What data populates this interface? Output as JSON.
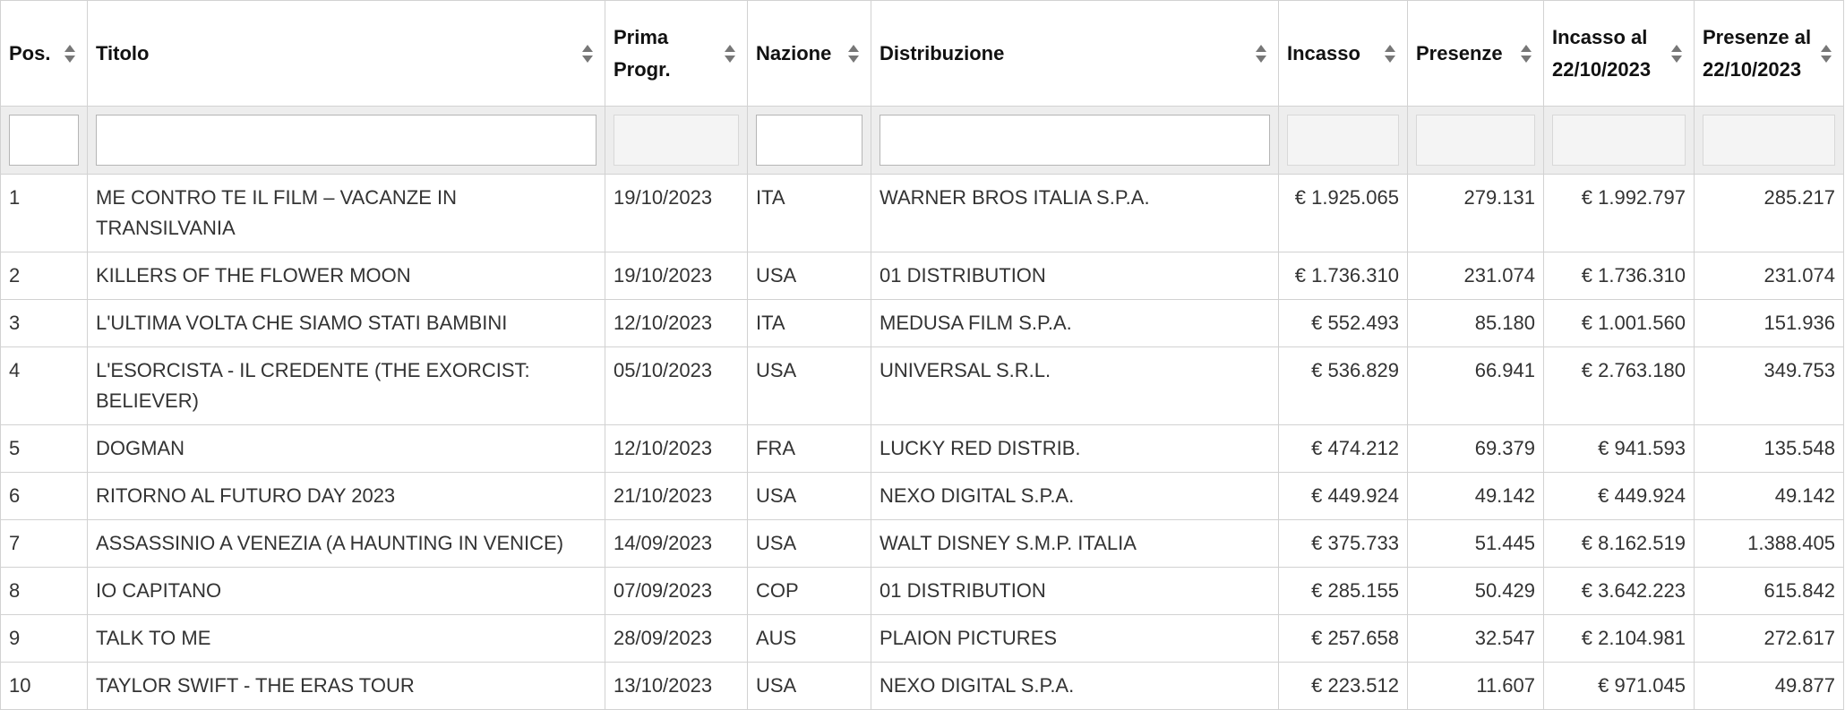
{
  "table": {
    "columns": [
      {
        "key": "pos",
        "label": "Pos."
      },
      {
        "key": "titolo",
        "label": "Titolo"
      },
      {
        "key": "prima",
        "label": "Prima Progr."
      },
      {
        "key": "nazione",
        "label": "Nazione"
      },
      {
        "key": "distribuzione",
        "label": "Distribuzione"
      },
      {
        "key": "incasso",
        "label": "Incasso"
      },
      {
        "key": "presenze",
        "label": "Presenze"
      },
      {
        "key": "incasso_al",
        "label": "Incasso al 22/10/2023"
      },
      {
        "key": "presenze_al",
        "label": "Presenze al 22/10/2023"
      }
    ],
    "filters": {
      "pos": "",
      "titolo": "",
      "prima": "",
      "nazione": "",
      "distribuzione": "",
      "incasso": "",
      "presenze": "",
      "incasso_al": "",
      "presenze_al": ""
    },
    "rows": [
      {
        "pos": "1",
        "titolo": "ME CONTRO TE IL FILM – VACANZE IN TRANSILVANIA",
        "prima": "19/10/2023",
        "nazione": "ITA",
        "distribuzione": "WARNER BROS ITALIA S.P.A.",
        "incasso": "€ 1.925.065",
        "presenze": "279.131",
        "incasso_al": "€ 1.992.797",
        "presenze_al": "285.217"
      },
      {
        "pos": "2",
        "titolo": "KILLERS OF THE FLOWER MOON",
        "prima": "19/10/2023",
        "nazione": "USA",
        "distribuzione": "01 DISTRIBUTION",
        "incasso": "€ 1.736.310",
        "presenze": "231.074",
        "incasso_al": "€ 1.736.310",
        "presenze_al": "231.074"
      },
      {
        "pos": "3",
        "titolo": "L'ULTIMA VOLTA CHE SIAMO STATI BAMBINI",
        "prima": "12/10/2023",
        "nazione": "ITA",
        "distribuzione": "MEDUSA FILM S.P.A.",
        "incasso": "€ 552.493",
        "presenze": "85.180",
        "incasso_al": "€ 1.001.560",
        "presenze_al": "151.936"
      },
      {
        "pos": "4",
        "titolo": "L'ESORCISTA - IL CREDENTE (THE EXORCIST: BELIEVER)",
        "prima": "05/10/2023",
        "nazione": "USA",
        "distribuzione": "UNIVERSAL S.R.L.",
        "incasso": "€ 536.829",
        "presenze": "66.941",
        "incasso_al": "€ 2.763.180",
        "presenze_al": "349.753"
      },
      {
        "pos": "5",
        "titolo": "DOGMAN",
        "prima": "12/10/2023",
        "nazione": "FRA",
        "distribuzione": "LUCKY RED DISTRIB.",
        "incasso": "€ 474.212",
        "presenze": "69.379",
        "incasso_al": "€ 941.593",
        "presenze_al": "135.548"
      },
      {
        "pos": "6",
        "titolo": "RITORNO AL FUTURO DAY 2023",
        "prima": "21/10/2023",
        "nazione": "USA",
        "distribuzione": "NEXO DIGITAL S.P.A.",
        "incasso": "€ 449.924",
        "presenze": "49.142",
        "incasso_al": "€ 449.924",
        "presenze_al": "49.142"
      },
      {
        "pos": "7",
        "titolo": "ASSASSINIO A VENEZIA (A HAUNTING IN VENICE)",
        "prima": "14/09/2023",
        "nazione": "USA",
        "distribuzione": "WALT DISNEY S.M.P. ITALIA",
        "incasso": "€ 375.733",
        "presenze": "51.445",
        "incasso_al": "€ 8.162.519",
        "presenze_al": "1.388.405"
      },
      {
        "pos": "8",
        "titolo": "IO CAPITANO",
        "prima": "07/09/2023",
        "nazione": "COP",
        "distribuzione": "01 DISTRIBUTION",
        "incasso": "€ 285.155",
        "presenze": "50.429",
        "incasso_al": "€ 3.642.223",
        "presenze_al": "615.842"
      },
      {
        "pos": "9",
        "titolo": "TALK TO ME",
        "prima": "28/09/2023",
        "nazione": "AUS",
        "distribuzione": "PLAION PICTURES",
        "incasso": "€ 257.658",
        "presenze": "32.547",
        "incasso_al": "€ 2.104.981",
        "presenze_al": "272.617"
      },
      {
        "pos": "10",
        "titolo": "TAYLOR SWIFT - THE ERAS TOUR",
        "prima": "13/10/2023",
        "nazione": "USA",
        "distribuzione": "NEXO DIGITAL S.P.A.",
        "incasso": "€ 223.512",
        "presenze": "11.607",
        "incasso_al": "€ 971.045",
        "presenze_al": "49.877"
      }
    ]
  }
}
